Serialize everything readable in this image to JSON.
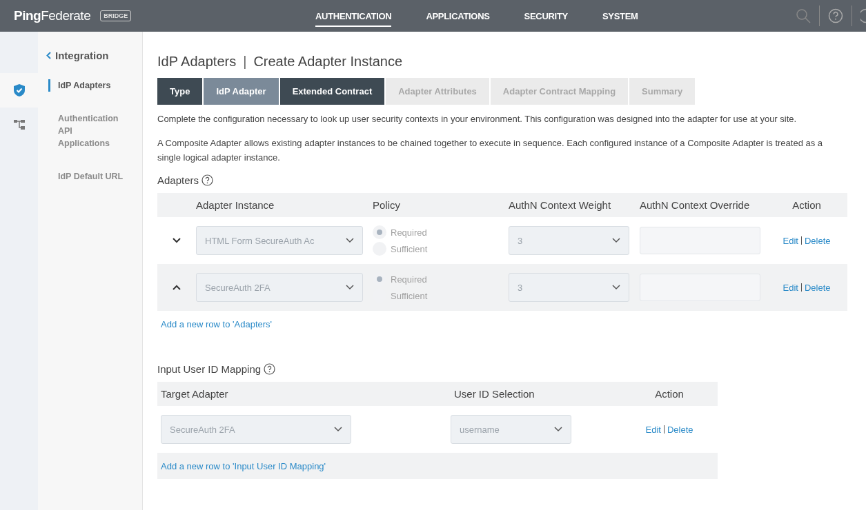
{
  "header": {
    "logo_bold": "Ping",
    "logo_light": "Federate",
    "badge": "BRIDGE",
    "nav": [
      {
        "label": "AUTHENTICATION",
        "selected": true
      },
      {
        "label": "APPLICATIONS",
        "selected": false
      },
      {
        "label": "SECURITY",
        "selected": false
      },
      {
        "label": "SYSTEM",
        "selected": false
      }
    ]
  },
  "rail": [
    {
      "kind": "shield",
      "selected": true
    },
    {
      "kind": "tree",
      "selected": false
    }
  ],
  "sidebar": {
    "back": "Integration",
    "items": [
      {
        "label": "IdP Adapters",
        "selected": true
      },
      {
        "label": "Authentication API Applications",
        "selected": false
      },
      {
        "label": "IdP Default URL",
        "selected": false
      }
    ]
  },
  "page": {
    "title": "IdP Adapters",
    "separator": "|",
    "subtitle": "Create Adapter Instance"
  },
  "steps": [
    {
      "label": "Type",
      "selected": false,
      "completed": true
    },
    {
      "label": "IdP Adapter",
      "selected": true,
      "completed": true
    },
    {
      "label": "Extended Contract",
      "selected": false,
      "completed": true
    },
    {
      "label": "Adapter Attributes",
      "selected": false,
      "completed": false
    },
    {
      "label": "Adapter Contract Mapping",
      "selected": false,
      "completed": false
    },
    {
      "label": "Summary",
      "selected": false,
      "completed": false
    }
  ],
  "paragraphs": [
    "Complete the configuration necessary to look up user security contexts in your environment. This configuration was designed into the adapter for use at your site.",
    "A Composite Adapter allows existing adapter instances to be chained together to execute in sequence. Each configured instance of a Composite Adapter is treated as a single logical adapter instance."
  ],
  "adapters": {
    "heading": "Adapters",
    "columns": [
      "Adapter Instance",
      "Policy",
      "AuthN Context Weight",
      "AuthN Context Override",
      "Action"
    ],
    "rows": [
      {
        "expanded": false,
        "instance": "HTML Form SecureAuth Ac",
        "policy": [
          {
            "label": "Required",
            "selected": true
          },
          {
            "label": "Sufficient",
            "selected": false
          }
        ],
        "weight": "3",
        "edit": "Edit",
        "delete": "Delete"
      },
      {
        "expanded": true,
        "instance": "SecureAuth 2FA",
        "policy": [
          {
            "label": "Required",
            "selected": true
          },
          {
            "label": "Sufficient",
            "selected": false
          }
        ],
        "weight": "3",
        "edit": "Edit",
        "delete": "Delete"
      }
    ],
    "add_link": "Add a new row to 'Adapters'"
  },
  "mapping": {
    "heading": "Input User ID Mapping",
    "columns": [
      "Target Adapter",
      "User ID Selection",
      "Action"
    ],
    "rows": [
      {
        "target": "SecureAuth 2FA",
        "selection": "username",
        "edit": "Edit",
        "delete": "Delete"
      }
    ],
    "add_link": "Add a new row to 'Input User ID Mapping'"
  }
}
